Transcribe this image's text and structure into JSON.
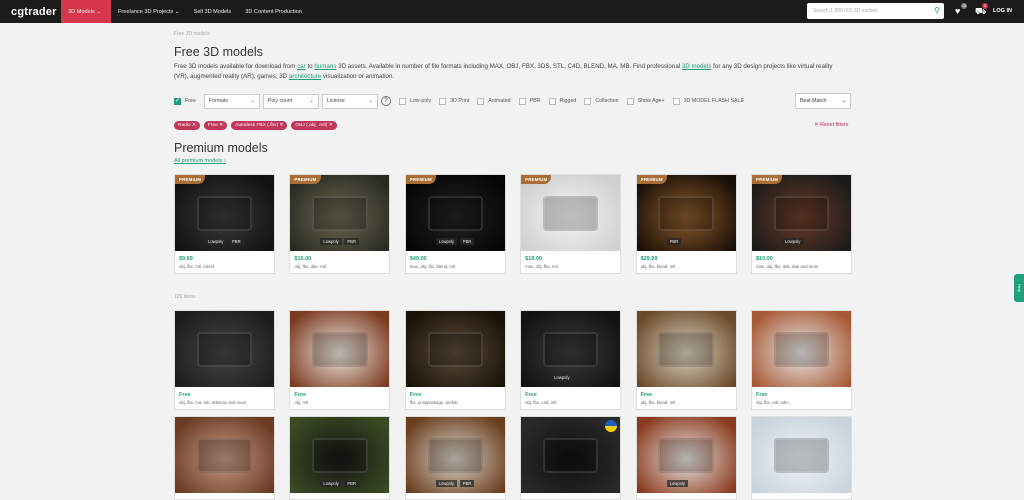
{
  "header": {
    "logo": "cgtrader",
    "nav": [
      "3D Models",
      "Freelance 3D Projects",
      "Sell 3D Models",
      "3D Content Production"
    ],
    "search_placeholder": "Search 1 980 000 3D models",
    "notif_count": "15",
    "cart_count": "0",
    "login": "LOG IN"
  },
  "breadcrumb": "Free 3D models",
  "page": {
    "title": "Free 3D models",
    "desc_1": "Free 3D models available for download from ",
    "link_car": "car",
    "desc_2": " to ",
    "link_humans": "humans",
    "desc_3": " 3D assets. Available in number of file formats including MAX, OBJ, FBX, 3DS, STL, C4D, BLEND, MA, MB. Find professional ",
    "link_models": "3D models",
    "desc_4": " for any 3D design projects like virtual reality (VR), augmented reality (AR), games, 3D ",
    "link_arch": "architecture",
    "desc_5": " visualization or animation."
  },
  "filters": {
    "free": "Free",
    "formats": "Formats",
    "poly": "Poly count",
    "license": "License",
    "help": "?",
    "checks": [
      "Low-poly",
      "3D Print",
      "Animated",
      "PBR",
      "Rigged",
      "Collection",
      "Show Age+",
      "3D MODEL FLASH SALE"
    ],
    "sort": "Best Match"
  },
  "tags": [
    "Radio",
    "Free",
    "Autodesk FBX (.fbx)",
    "OBJ (.obj, .mtl)"
  ],
  "reset": "Reset filters",
  "premium": {
    "title": "Premium models",
    "all": "All premium models",
    "badge": "PREMIUM",
    "cards": [
      {
        "price": "$9.99",
        "formats": "obj, fbx, mtl, blend",
        "chips": [
          "Lowpoly",
          "PBR"
        ],
        "colors": [
          "#3a3a3a",
          "#111111"
        ]
      },
      {
        "price": "$15.00",
        "formats": "obj, fbx, dae, mtl",
        "chips": [
          "Lowpoly",
          "PBR"
        ],
        "colors": [
          "#6b6652",
          "#2b2a22"
        ]
      },
      {
        "price": "$40.00",
        "formats": "max, obj, fbx, blend, mtl",
        "chips": [
          "Lowpoly",
          "PBR"
        ],
        "colors": [
          "#222222",
          "#050505"
        ]
      },
      {
        "price": "$19.00",
        "formats": "max, obj, fbx, mtl",
        "chips": [],
        "colors": [
          "#f4f4f4",
          "#cfcfcf"
        ]
      },
      {
        "price": "$29.99",
        "formats": "obj, fbx, blend, mtl",
        "chips": [
          "PBR"
        ],
        "colors": [
          "#8a5a2a",
          "#1a0f08"
        ]
      },
      {
        "price": "$10.00",
        "formats": "max, obj, fbx, 3ds, dae and more",
        "chips": [
          "Lowpoly"
        ],
        "colors": [
          "#6b3b26",
          "#1a1a1a"
        ]
      }
    ]
  },
  "items_count": "126 items",
  "row1": [
    {
      "price": "Free",
      "formats": "obj, fbx, ma, mb, 3dsmax and more",
      "colors": [
        "#444444",
        "#1d1d1d"
      ]
    },
    {
      "price": "Free",
      "formats": "obj, mtl",
      "colors": [
        "#efe8df",
        "#7c3c22"
      ]
    },
    {
      "price": "Free",
      "formats": "fbx, unitypackage, prefab",
      "colors": [
        "#5a4a3a",
        "#1a1208"
      ]
    },
    {
      "price": "Free",
      "formats": "obj, fbx, c4d, mtl",
      "chips": [
        "Lowpoly"
      ],
      "colors": [
        "#3a3a3a",
        "#121212"
      ]
    },
    {
      "price": "Free",
      "formats": "obj, fbx, blend, mtl",
      "colors": [
        "#dcd3c0",
        "#6b4a2a"
      ]
    },
    {
      "price": "Free",
      "formats": "obj, fbx, mtl, 3dm",
      "colors": [
        "#e8e8e8",
        "#a85a36"
      ]
    }
  ],
  "row2": [
    {
      "colors": [
        "#c69a86",
        "#6a3a22"
      ]
    },
    {
      "chips": [
        "Lowpoly",
        "PBR"
      ],
      "colors": [
        "#151515",
        "#3a4a22"
      ]
    },
    {
      "chips": [
        "Lowpoly",
        "PBR"
      ],
      "colors": [
        "#d8d3c8",
        "#6b3e1e"
      ]
    },
    {
      "colors": [
        "#101010",
        "#2a2a2a"
      ],
      "flag": true
    },
    {
      "chips": [
        "Lowpoly"
      ],
      "colors": [
        "#e8e4e0",
        "#8a3a1e"
      ]
    },
    {
      "colors": [
        "#eef2f6",
        "#c9d3dc"
      ]
    }
  ],
  "feedback": "Help"
}
